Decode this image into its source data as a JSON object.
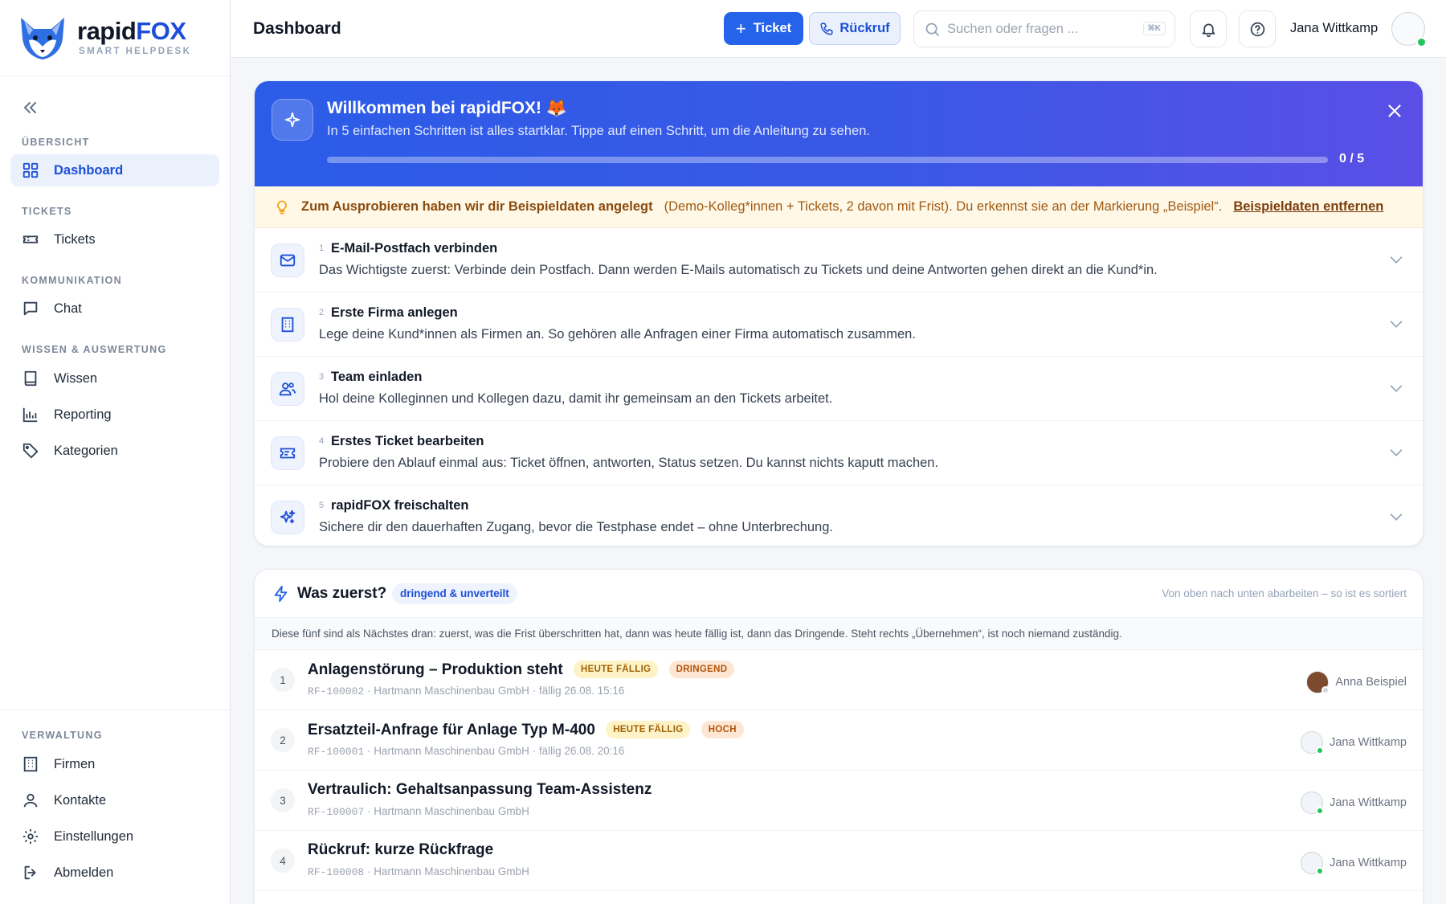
{
  "brand": {
    "name_part1": "rapid",
    "name_part2": "FOX",
    "subtitle": "SMART HELPDESK"
  },
  "sidebar": {
    "sections": {
      "overview": "ÜBERSICHT",
      "tickets": "TICKETS",
      "communication": "KOMMUNIKATION",
      "knowledge": "WISSEN & AUSWERTUNG",
      "admin": "VERWALTUNG"
    },
    "items": {
      "dashboard": "Dashboard",
      "tickets": "Tickets",
      "chat": "Chat",
      "wissen": "Wissen",
      "reporting": "Reporting",
      "kategorien": "Kategorien",
      "firmen": "Firmen",
      "kontakte": "Kontakte",
      "einstellungen": "Einstellungen",
      "abmelden": "Abmelden"
    }
  },
  "header": {
    "title": "Dashboard",
    "ticket_button": "Ticket",
    "callback_button": "Rückruf",
    "search_placeholder": "Suchen oder fragen ...",
    "search_shortcut": "⌘K",
    "user_name": "Jana Wittkamp"
  },
  "onboarding": {
    "title": "Willkommen bei rapidFOX! 🦊",
    "subtitle": "In 5 einfachen Schritten ist alles startklar. Tippe auf einen Schritt, um die Anleitung zu sehen.",
    "progress_done": 0,
    "progress_total": 5,
    "progress_label": "0 / 5",
    "notice_strong": "Zum Ausprobieren haben wir dir Beispieldaten angelegt",
    "notice_rest": "(Demo-Kolleg*innen + Tickets, 2 davon mit Frist). Du erkennst sie an der Markierung „Beispiel“.",
    "notice_link": "Beispieldaten entfernen",
    "steps": [
      {
        "num": "1",
        "title": "E-Mail-Postfach verbinden",
        "desc": "Das Wichtigste zuerst: Verbinde dein Postfach. Dann werden E-Mails automatisch zu Tickets und deine Antworten gehen direkt an die Kund*in.",
        "icon": "mail-icon"
      },
      {
        "num": "2",
        "title": "Erste Firma anlegen",
        "desc": "Lege deine Kund*innen als Firmen an. So gehören alle Anfragen einer Firma automatisch zusammen.",
        "icon": "building-icon"
      },
      {
        "num": "3",
        "title": "Team einladen",
        "desc": "Hol deine Kolleginnen und Kollegen dazu, damit ihr gemeinsam an den Tickets arbeitet.",
        "icon": "users-icon"
      },
      {
        "num": "4",
        "title": "Erstes Ticket bearbeiten",
        "desc": "Probiere den Ablauf einmal aus: Ticket öffnen, antworten, Status setzen. Du kannst nichts kaputt machen.",
        "icon": "ticket-icon"
      },
      {
        "num": "5",
        "title": "rapidFOX freischalten",
        "desc": "Sichere dir den dauerhaften Zugang, bevor die Testphase endet – ohne Unterbrechung.",
        "icon": "sparkles-icon"
      }
    ]
  },
  "was_zuerst": {
    "title": "Was zuerst?",
    "pill": "dringend & unverteilt",
    "hint": "Von oben nach unten abarbeiten – so ist es sortiert",
    "description": "Diese fünf sind als Nächstes dran: zuerst, was die Frist überschritten hat, dann was heute fällig ist, dann das Dringende. Steht rechts „Übernehmen“, ist noch niemand zuständig.",
    "tickets": [
      {
        "idx": "1",
        "title": "Anlagenstörung – Produktion steht",
        "tag1": "HEUTE FÄLLIG",
        "tag2": "DRINGEND",
        "code": "RF-100002",
        "company": "· Hartmann Maschinenbau GmbH",
        "due": "· fällig 26.08. 15:16",
        "assignee": "Anna Beispiel"
      },
      {
        "idx": "2",
        "title": "Ersatzteil-Anfrage für Anlage Typ M-400",
        "tag1": "HEUTE FÄLLIG",
        "tag2": "HOCH",
        "code": "RF-100001",
        "company": "· Hartmann Maschinenbau GmbH",
        "due": "· fällig 26.08. 20:16",
        "assignee": "Jana Wittkamp"
      },
      {
        "idx": "3",
        "title": "Vertraulich: Gehaltsanpassung Team-Assistenz",
        "code": "RF-100007",
        "company": "· Hartmann Maschinenbau GmbH",
        "assignee": "Jana Wittkamp"
      },
      {
        "idx": "4",
        "title": "Rückruf: kurze Rückfrage",
        "code": "RF-100008",
        "company": "· Hartmann Maschinenbau GmbH",
        "assignee": "Jana Wittkamp"
      }
    ]
  },
  "colors": {
    "primary": "#2563eb",
    "banner_start": "#2b5ce8",
    "banner_end": "#5a4fe6",
    "notice_bg": "#fff8e6",
    "online": "#22c55e"
  }
}
